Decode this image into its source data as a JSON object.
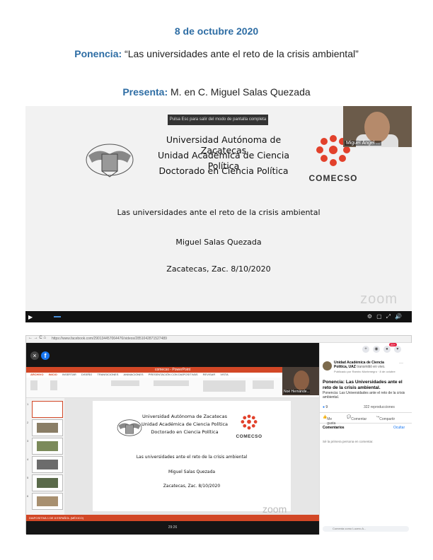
{
  "header": {
    "date": "8 de octubre 2020",
    "talk_label": "Ponencia:",
    "talk_title": "“Las universidades ante el reto de la crisis ambiental”",
    "presenter_label": "Presenta:",
    "presenter_name": "M. en C. Miguel Salas Quezada"
  },
  "slide": {
    "university": "Universidad Autónoma de Zacatecas",
    "unit": "Unidad Académica de Ciencia Política",
    "program": "Doctorado en Ciencia Política",
    "logo_text": "COMECSO",
    "title": "Las universidades ante el reto de la crisis ambiental",
    "author": "Miguel Salas Quezada",
    "place_date": "Zacatecas, Zac. 8/10/2020"
  },
  "zoom": {
    "fullscreen_hint": "Pulsa Esc para salir del modo de pantalla completa",
    "participant_1": "Miguel Ángel ...",
    "participant_2": "Noé Hernánde...",
    "watermark": "zoom"
  },
  "browser": {
    "url": "https://www.facebook.com/290134457064476/videos/2851042871527489"
  },
  "powerpoint": {
    "window_title": "comecso - PowerPoint",
    "tabs": [
      "ARCHIVO",
      "INICIO",
      "INSERTAR",
      "DISEÑO",
      "TRANSICIONES",
      "ANIMACIONES",
      "PRESENTACIÓN CON DIAPOSITIVAS",
      "REVISAR",
      "VISTA"
    ],
    "status": "DIAPOSITIVA 1 DE 8     ESPAÑOL (MÉXICO)",
    "thumb_numbers": [
      "1",
      "2",
      "3",
      "4",
      "5",
      "6"
    ]
  },
  "facebook": {
    "page_name": "Unidad Académica de Ciencia Política, UAZ",
    "page_status": "transmitió en vivo.",
    "by_line": "Publicado por Ramiro Montenegro · 8 de octubre",
    "headline": "Ponencia: Las Universidades ante el reto de la crisis ambiental.",
    "description": "Ponencia: Las Universidades ante el reto de la crisis ambiental.",
    "reactions": "9",
    "views": "322 reproducciones",
    "like": "Me gusta",
    "comment": "Comentar",
    "share": "Compartir",
    "comments_label": "Comentarios",
    "filter": "Ocultar",
    "first_comment": "Sé la primera persona en comentar.",
    "comment_placeholder": "Comenta como Lucero A...",
    "badge": "20+",
    "bottom_caption": "29:26"
  },
  "colors": {
    "heading_blue": "#2e6da4",
    "powerpoint_orange": "#d24726",
    "facebook_blue": "#1877f2",
    "comecso_red": "#e2412b"
  }
}
